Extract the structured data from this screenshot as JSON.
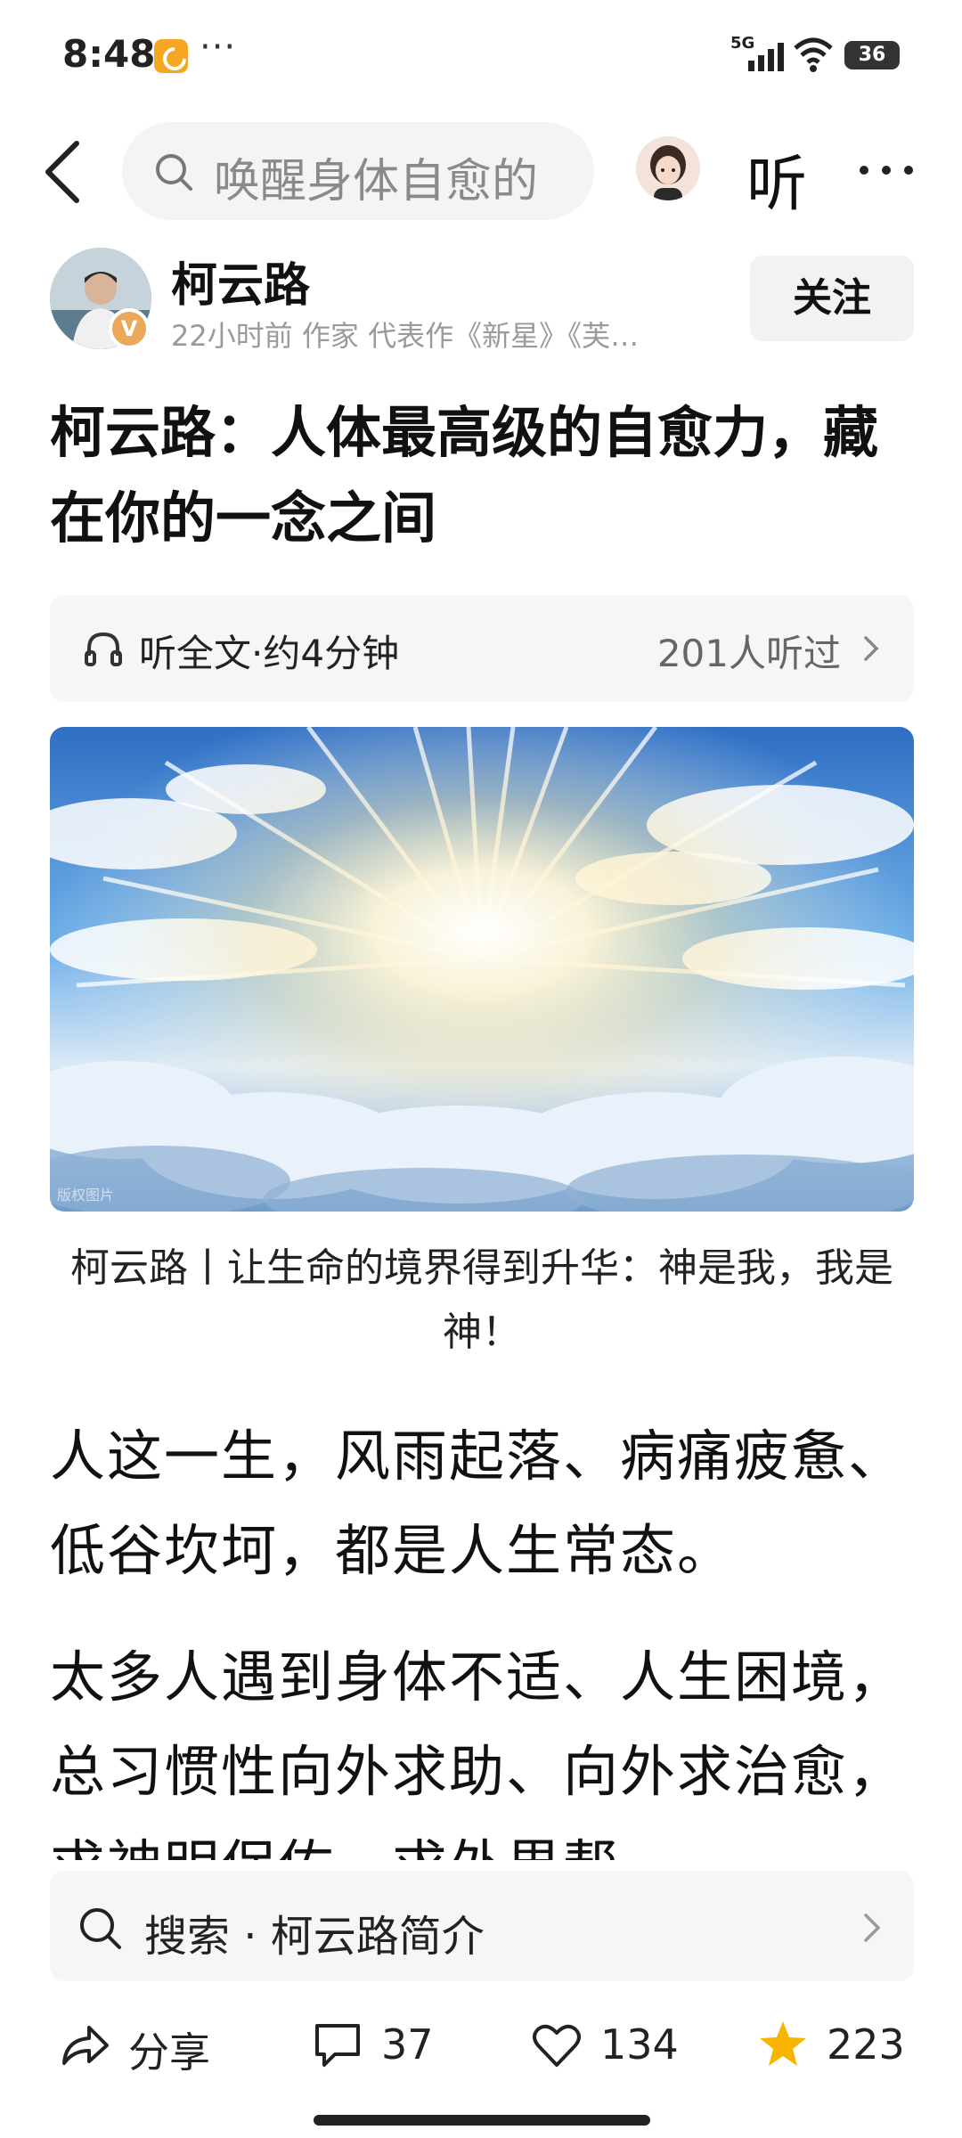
{
  "status_bar": {
    "time": "8:48",
    "more": "···",
    "network": "5G",
    "battery": "36"
  },
  "top_nav": {
    "search_placeholder": "唤醒身体自愈的",
    "listen_label": "听"
  },
  "author": {
    "name": "柯云路",
    "meta": "22小时前  作家 代表作《新星》《芙…",
    "verified_badge": "V",
    "follow_label": "关注"
  },
  "article": {
    "title": "柯云路：人体最高级的自愈力，藏在你的一念之间",
    "listen_bar": {
      "label": "听全文·约4分钟",
      "count": "201人听过"
    },
    "image_watermark": "版权图片",
    "caption": "柯云路丨让生命的境界得到升华：神是我，我是神！",
    "paragraphs": [
      "人这一生，风雨起落、病痛疲惫、低谷坎坷，都是人生常态。",
      "太多人遇到身体不适、人生困境，总习惯性向外求助、向外求治愈，求神明保佑，求外界帮"
    ]
  },
  "bottom_search": {
    "text": "搜索 · 柯云路简介"
  },
  "actions": {
    "share_label": "分享",
    "comment_count": "37",
    "like_count": "134",
    "favorite_count": "223"
  },
  "colors": {
    "star": "#f7b500",
    "badge": "#e9a85a",
    "app_icon": "#f5a623"
  }
}
